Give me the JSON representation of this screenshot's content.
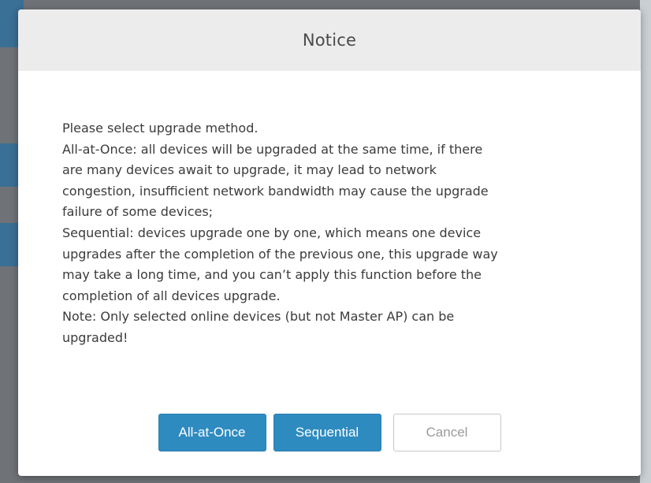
{
  "dialog": {
    "title": "Notice",
    "message_lines": [
      "Please select upgrade method.",
      "All-at-Once: all devices will be upgraded at the same time, if there",
      "are many devices await to upgrade, it may lead to network",
      "congestion, insufficient network bandwidth may cause the upgrade",
      "failure of some devices;",
      "Sequential: devices upgrade one by one, which means one device",
      "upgrades after the completion of the previous one, this upgrade way",
      "may take a long time, and you can’t apply this function before the",
      "completion of all devices upgrade.",
      "Note: Only selected online devices (but not Master AP) can be",
      "upgraded!"
    ],
    "buttons": {
      "all_at_once": "All-at-Once",
      "sequential": "Sequential",
      "cancel": "Cancel"
    }
  },
  "colors": {
    "primary": "#2e8bc0",
    "header_bg": "#ececec",
    "overlay": "#6f7377"
  }
}
